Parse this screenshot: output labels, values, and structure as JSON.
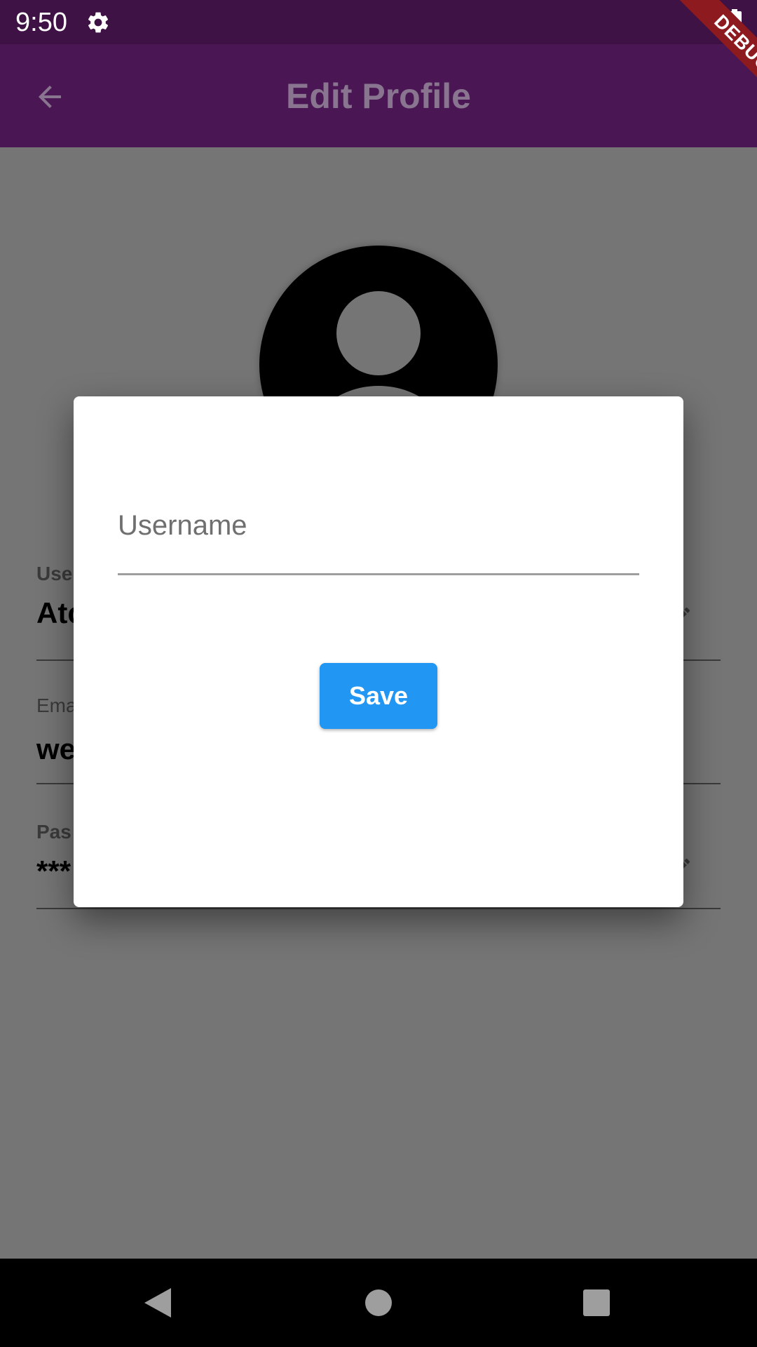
{
  "status_bar": {
    "time": "9:50"
  },
  "app_bar": {
    "title": "Edit Profile",
    "debug_label": "DEBUG"
  },
  "profile": {
    "fields": [
      {
        "label": "Use",
        "value": "Atc"
      },
      {
        "label": "Ema",
        "value": "we"
      },
      {
        "label": "Pas",
        "value": "***"
      }
    ]
  },
  "dialog": {
    "username_placeholder": "Username",
    "save_label": "Save"
  },
  "colors": {
    "status_bar": "#3f1245",
    "app_bar": "#4a1654",
    "scrim_page": "#757575",
    "save_button": "#2196f3",
    "debug_ribbon": "#8c1a1f"
  },
  "icons": {
    "status": [
      "gear-icon",
      "battery-icon"
    ],
    "app_bar": [
      "back-arrow-icon"
    ],
    "fields": [
      "pencil-icon"
    ],
    "nav": [
      "nav-back-icon",
      "nav-home-icon",
      "nav-recents-icon"
    ]
  }
}
